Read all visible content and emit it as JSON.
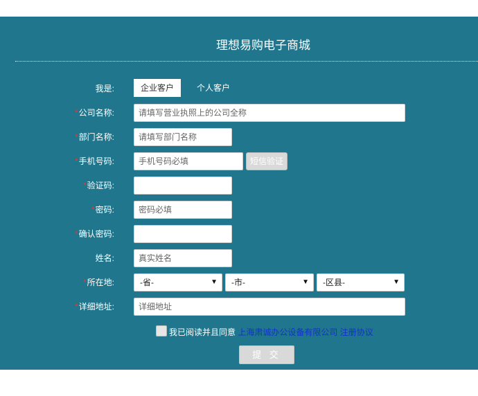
{
  "page": {
    "title": "理想易购电子商城"
  },
  "form": {
    "customer_type": {
      "label": "我是:",
      "options": [
        "企业客户",
        "个人客户"
      ],
      "selected": "企业客户"
    },
    "company": {
      "required": true,
      "label": "公司名称:",
      "placeholder": "请填写营业执照上的公司全称"
    },
    "department": {
      "required": true,
      "label": "部门名称:",
      "placeholder": "请填写部门名称"
    },
    "phone": {
      "required": true,
      "label": "手机号码:",
      "placeholder": "手机号码必填",
      "sms_button": "短信验证"
    },
    "captcha": {
      "required": true,
      "label": "验证码:",
      "placeholder": ""
    },
    "password": {
      "required": true,
      "label": "密码:",
      "placeholder": "密码必填"
    },
    "confirm_password": {
      "required": true,
      "label": "确认密码:",
      "placeholder": ""
    },
    "name": {
      "required": false,
      "label": "姓名:",
      "placeholder": "真实姓名"
    },
    "location": {
      "required": true,
      "label": "所在地:",
      "province": "-省-",
      "city": "-市-",
      "district": "-区县-"
    },
    "address": {
      "required": true,
      "label": "详细地址:",
      "placeholder": "详细地址"
    },
    "agreement": {
      "text": "我已阅读并且同意",
      "company_link": "上海肃诚办公设备有限公司",
      "protocol_link": "注册协议",
      "checked": false
    },
    "submit_label": "提 交",
    "required_mark": "*"
  },
  "colors": {
    "panel_bg": "#1f768d",
    "required_mark": "#e23a3a",
    "link": "#1133cc"
  }
}
